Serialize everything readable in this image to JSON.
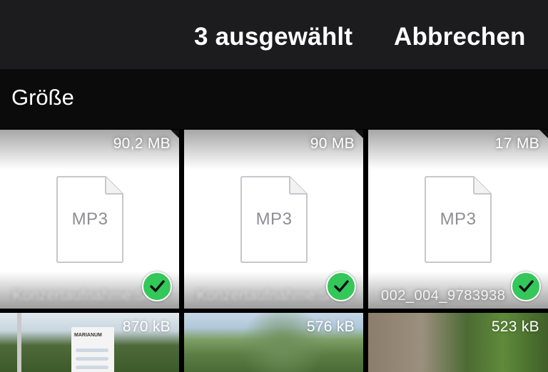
{
  "header": {
    "selected_count_label": "3 ausgewählt",
    "cancel_label": "Abbrechen"
  },
  "sort": {
    "label": "Größe"
  },
  "files": [
    {
      "size": "90,2 MB",
      "type_label": "MP3",
      "name": "Konzertaufnahme Seite",
      "selected": true
    },
    {
      "size": "90 MB",
      "type_label": "MP3",
      "name": "Konzertaufnahme Seite",
      "selected": true
    },
    {
      "size": "17 MB",
      "type_label": "MP3",
      "name": "002_004_9783938",
      "selected": true
    },
    {
      "size": "870 kB",
      "kind": "photo",
      "sign_text": "MARIANUM"
    },
    {
      "size": "576 kB",
      "kind": "photo"
    },
    {
      "size": "523 kB",
      "kind": "photo"
    }
  ],
  "colors": {
    "header_bg": "#1c1c1e",
    "sort_bar_bg": "#0b0b0b",
    "selection_green": "#34c759",
    "file_icon_gray": "#8e8e93"
  },
  "icons": {
    "file": "document-file-icon",
    "selected": "checkmark-circle-icon"
  }
}
